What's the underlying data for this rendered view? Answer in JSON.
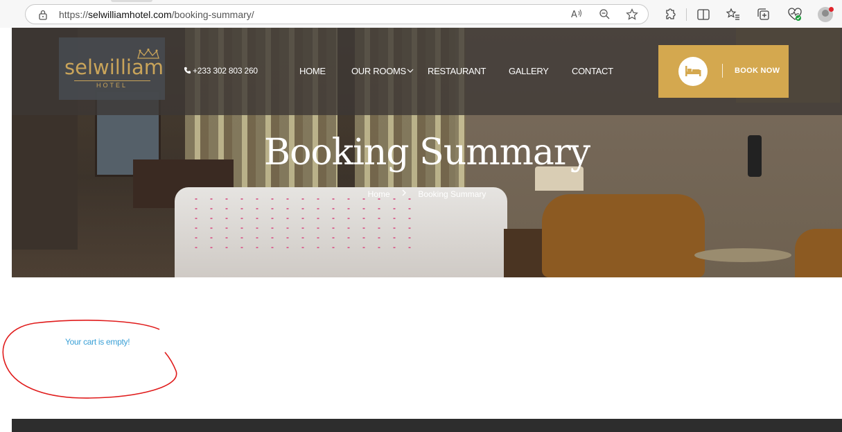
{
  "browser": {
    "url_prefix": "https://",
    "url_domain": "selwilliamhotel.com",
    "url_path": "/booking-summary/",
    "icons": [
      "lock-icon",
      "read-aloud-icon",
      "zoom-out-icon",
      "favorite-star-icon",
      "extensions-icon",
      "split-screen-icon",
      "favorites-icon",
      "collections-icon",
      "performance-icon",
      "profile-icon"
    ]
  },
  "header": {
    "logo_text": "selwilliam",
    "logo_subtext": "HOTEL",
    "phone": "+233 302 803 260",
    "nav": {
      "home": "HOME",
      "rooms": "OUR ROOMS",
      "restaurant": "RESTAURANT",
      "gallery": "GALLERY",
      "contact": "CONTACT"
    },
    "book_now": "BOOK NOW"
  },
  "hero": {
    "title": "Booking Summary",
    "breadcrumb": [
      "Home",
      "Booking Summary"
    ]
  },
  "content": {
    "cart_message": "Your cart is empty!"
  },
  "colors": {
    "accent_gold": "#d4a84f",
    "link_blue": "#3aa0d6",
    "annotation_red": "#e01b1b",
    "footer_dark": "#2d2d2d"
  }
}
